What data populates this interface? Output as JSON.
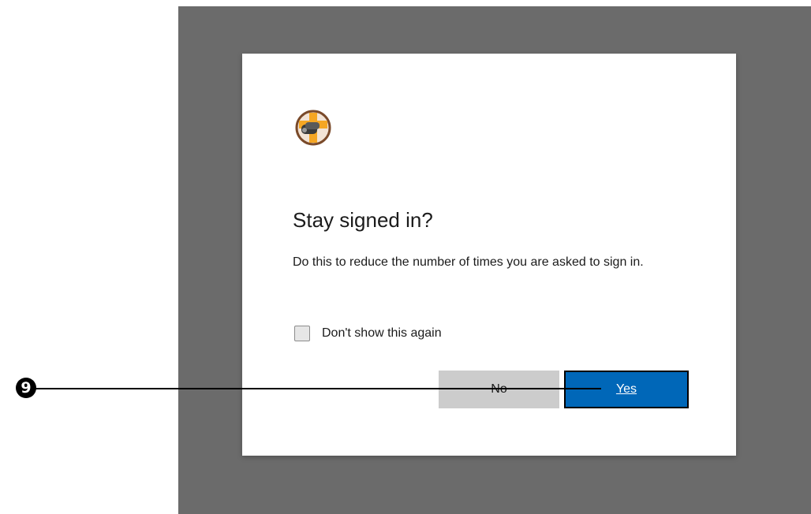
{
  "dialog": {
    "logo_icon": "cross-shield-logo-icon",
    "title": "Stay signed in?",
    "description": "Do this to reduce the number of times you are asked to sign in.",
    "checkbox_label": "Don't show this again",
    "checkbox_checked": false,
    "no_label": "No",
    "yes_label": "Yes"
  },
  "callout": {
    "number": "9"
  },
  "colors": {
    "backdrop": "#6b6b6b",
    "primary": "#0067b8",
    "secondary_button": "#cccccc",
    "logo_orange": "#f5a623",
    "logo_ring": "#7a4a2a"
  }
}
